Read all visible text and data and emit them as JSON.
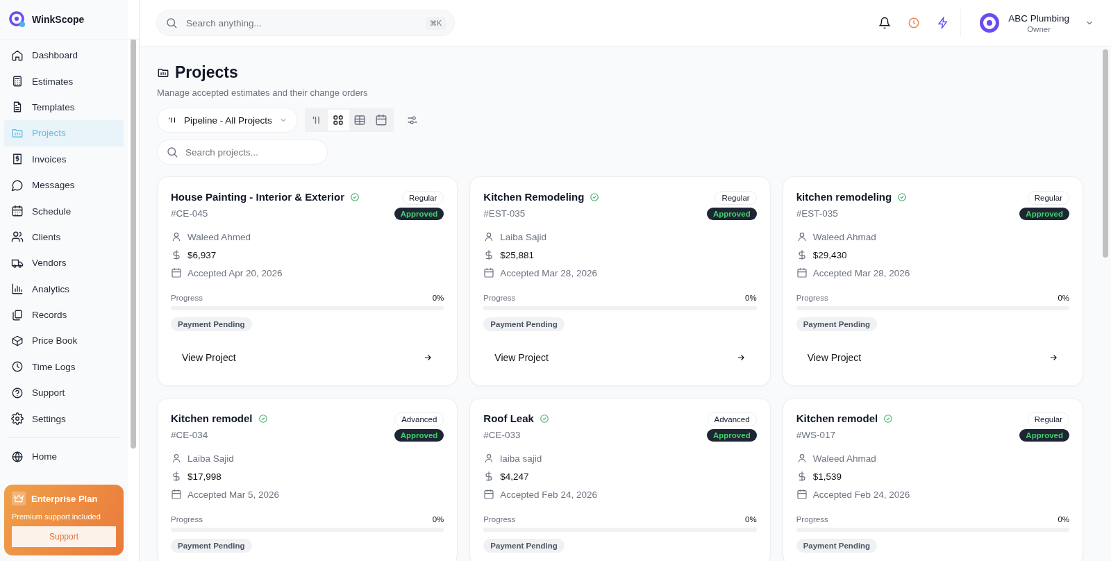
{
  "brand": {
    "name": "WinkScope"
  },
  "sidebar": {
    "items": [
      {
        "label": "Dashboard",
        "selected": false
      },
      {
        "label": "Estimates",
        "selected": false
      },
      {
        "label": "Templates",
        "selected": false
      },
      {
        "label": "Projects",
        "selected": true
      },
      {
        "label": "Invoices",
        "selected": false
      },
      {
        "label": "Messages",
        "selected": false
      },
      {
        "label": "Schedule",
        "selected": false
      },
      {
        "label": "Clients",
        "selected": false
      },
      {
        "label": "Vendors",
        "selected": false
      },
      {
        "label": "Analytics",
        "selected": false
      },
      {
        "label": "Records",
        "selected": false
      },
      {
        "label": "Price Book",
        "selected": false
      },
      {
        "label": "Time Logs",
        "selected": false
      },
      {
        "label": "Support",
        "selected": false
      },
      {
        "label": "Settings",
        "selected": false
      }
    ],
    "footer_items": [
      {
        "label": "Home",
        "selected": false
      }
    ],
    "plan": {
      "title": "Enterprise Plan",
      "subtitle": "Premium support included",
      "button": "Support"
    }
  },
  "topbar": {
    "search": {
      "placeholder": "Search anything...",
      "shortcut": "⌘K"
    },
    "account": {
      "name": "ABC Plumbing",
      "role": "Owner"
    }
  },
  "page": {
    "title": "Projects",
    "subtitle": "Manage accepted estimates and their change orders",
    "pipeline": "Pipeline - All Projects",
    "views": [
      {
        "selected": false
      },
      {
        "selected": true
      },
      {
        "selected": false
      },
      {
        "selected": false
      }
    ],
    "search": {
      "placeholder": "Search projects..."
    }
  },
  "projects": [
    {
      "title": "House Painting - Interior & Exterior",
      "code": "#CE-045",
      "tier": "Regular",
      "status": "Approved",
      "client": "Waleed Ahmed",
      "amount": "$6,937",
      "accepted": "Accepted Apr 20, 2026",
      "progress_label": "Progress",
      "percent": "0%",
      "level": 0,
      "payment": "Payment Pending",
      "action": "View Project"
    },
    {
      "title": "Kitchen Remodeling",
      "code": "#EST-035",
      "tier": "Regular",
      "status": "Approved",
      "client": "Laiba Sajid",
      "amount": "$25,881",
      "accepted": "Accepted Mar 28, 2026",
      "progress_label": "Progress",
      "percent": "0%",
      "level": 0,
      "payment": "Payment Pending",
      "action": "View Project"
    },
    {
      "title": "kitchen remodeling",
      "code": "#EST-035",
      "tier": "Regular",
      "status": "Approved",
      "client": "Waleed Ahmad",
      "amount": "$29,430",
      "accepted": "Accepted Mar 28, 2026",
      "progress_label": "Progress",
      "percent": "0%",
      "level": 0,
      "payment": "Payment Pending",
      "action": "View Project"
    },
    {
      "title": "Kitchen remodel",
      "code": "#CE-034",
      "tier": "Advanced",
      "status": "Approved",
      "client": "Laiba Sajid",
      "amount": "$17,998",
      "accepted": "Accepted Mar 5, 2026",
      "progress_label": "Progress",
      "percent": "0%",
      "level": 0,
      "payment": "Payment Pending"
    },
    {
      "title": "Roof Leak",
      "code": "#CE-033",
      "tier": "Advanced",
      "status": "Approved",
      "client": "laiba sajid",
      "amount": "$4,247",
      "accepted": "Accepted Feb 24, 2026",
      "progress_label": "Progress",
      "percent": "0%",
      "level": 0,
      "payment": "Payment Pending"
    },
    {
      "title": "Kitchen remodel",
      "code": "#WS-017",
      "tier": "Regular",
      "status": "Approved",
      "client": "Waleed Ahmad",
      "amount": "$1,539",
      "accepted": "Accepted Feb 24, 2026",
      "progress_label": "Progress",
      "percent": "0%",
      "level": 0,
      "payment": "Payment Pending"
    }
  ]
}
